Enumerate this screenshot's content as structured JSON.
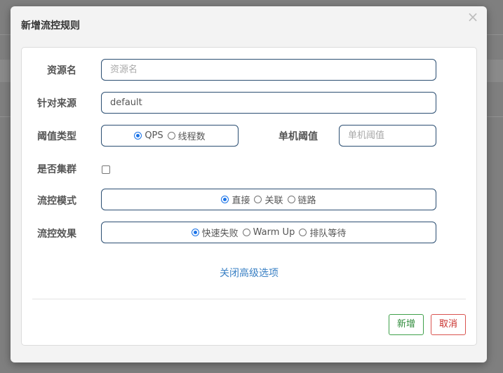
{
  "dialog": {
    "title": "新增流控规则",
    "close_symbol": "×"
  },
  "form": {
    "resource_name": {
      "label": "资源名",
      "value": "",
      "placeholder": "资源名"
    },
    "limit_app": {
      "label": "针对来源",
      "value": "default"
    },
    "threshold_type": {
      "label": "阈值类型",
      "options": [
        "QPS",
        "线程数"
      ],
      "selected": "QPS"
    },
    "single_threshold": {
      "label": "单机阈值",
      "value": "",
      "placeholder": "单机阈值"
    },
    "cluster_mode": {
      "label": "是否集群",
      "checked": false
    },
    "flow_mode": {
      "label": "流控模式",
      "options": [
        "直接",
        "关联",
        "链路"
      ],
      "selected": "直接"
    },
    "flow_effect": {
      "label": "流控效果",
      "options": [
        "快速失败",
        "Warm Up",
        "排队等待"
      ],
      "selected": "快速失败"
    },
    "advanced_toggle": "关闭高级选项"
  },
  "footer": {
    "add_label": "新增",
    "cancel_label": "取消"
  },
  "colors": {
    "input_border": "#2b4e72",
    "radio_checked": "#1a73e8",
    "link": "#3a80c4",
    "add_button": "#3fa04a",
    "cancel_button": "#d9534f"
  }
}
